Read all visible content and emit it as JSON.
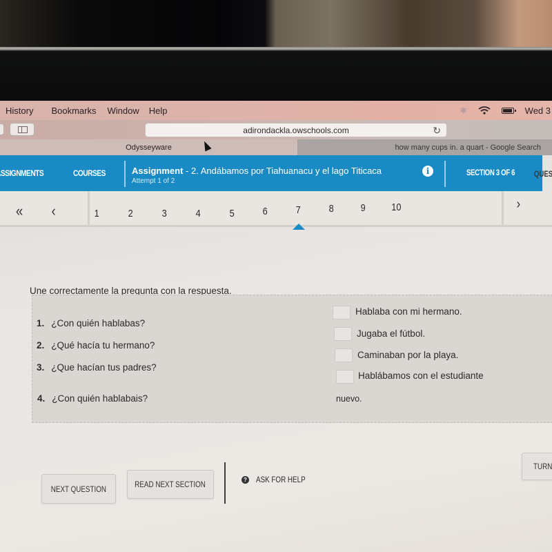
{
  "menubar": {
    "items": [
      "History",
      "Bookmarks",
      "Window",
      "Help"
    ],
    "clock": "Wed 3"
  },
  "browser": {
    "url": "adirondackla.owschools.com",
    "tabs": [
      {
        "label": "Odysseyware",
        "active": true
      },
      {
        "label": "how many cups in. a quart - Google Search",
        "active": false
      }
    ]
  },
  "header": {
    "nav": [
      "ASSIGNMENTS",
      "COURSES"
    ],
    "assignment_label": "Assignment",
    "assignment_title": "- 2. Andábamos por Tiahuanacu y el lago Titicaca",
    "attempt": "Attempt 1 of 2",
    "section": "SECTION 3 OF 6",
    "questions_label": "QUES",
    "accent_color": "#1a8ac4"
  },
  "pager": {
    "first_label": "«",
    "prev_label": "‹",
    "next_label": "›",
    "pages": [
      "1",
      "2",
      "3",
      "4",
      "5",
      "6",
      "7",
      "8",
      "9",
      "10"
    ],
    "current": "7"
  },
  "question": {
    "instruction": "Une correctamente la pregunta con la respuesta.",
    "prompts": [
      {
        "number": "1.",
        "text": "¿Con quién hablabas?"
      },
      {
        "number": "2.",
        "text": "¿Qué hacía tu hermano?"
      },
      {
        "number": "3.",
        "text": "¿Que hacían tus padres?"
      },
      {
        "number": "4.",
        "text": "¿Con quién hablabais?"
      }
    ],
    "answers": [
      "Hablaba con mi hermano.",
      "Jugaba el fútbol.",
      "Caminaban por la playa.",
      "Hablábamos con el estudiante"
    ],
    "answer_overflow": "nuevo."
  },
  "actions": {
    "next_question": "NEXT QUESTION",
    "read_next_section": "READ NEXT SECTION",
    "ask_for_help": "ASK FOR HELP",
    "turn_in": "TURN I"
  }
}
